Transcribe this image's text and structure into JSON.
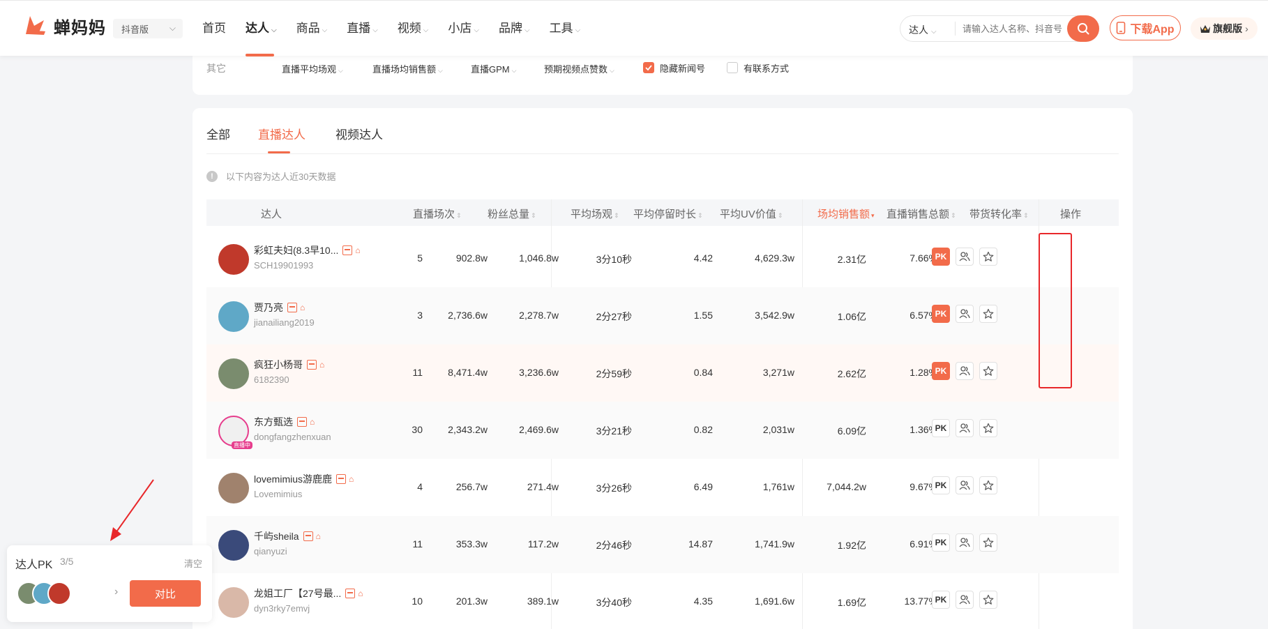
{
  "header": {
    "logo_text": "蝉妈妈",
    "edition": "抖音版",
    "nav": [
      {
        "label": "首页",
        "dropdown": false,
        "active": false
      },
      {
        "label": "达人",
        "dropdown": true,
        "active": true
      },
      {
        "label": "商品",
        "dropdown": true,
        "active": false
      },
      {
        "label": "直播",
        "dropdown": true,
        "active": false
      },
      {
        "label": "视频",
        "dropdown": true,
        "active": false
      },
      {
        "label": "小店",
        "dropdown": true,
        "active": false
      },
      {
        "label": "品牌",
        "dropdown": true,
        "active": false
      },
      {
        "label": "工具",
        "dropdown": true,
        "active": false
      }
    ],
    "search_type": "达人",
    "search_placeholder": "请输入达人名称、抖音号",
    "download_label": "下载App",
    "flagship_label": "旗舰版"
  },
  "filters": {
    "group_label": "其它",
    "dropdowns": [
      "直播平均场观",
      "直播场均销售额",
      "直播GPM",
      "预期视频点赞数"
    ],
    "checkboxes": [
      {
        "label": "隐藏新闻号",
        "checked": true
      },
      {
        "label": "有联系方式",
        "checked": false
      }
    ]
  },
  "tabs": [
    {
      "label": "全部",
      "active": false
    },
    {
      "label": "直播达人",
      "active": true
    },
    {
      "label": "视频达人",
      "active": false
    }
  ],
  "notice": "以下内容为达人近30天数据",
  "columns": [
    "达人",
    "直播场次",
    "粉丝总量",
    "平均场观",
    "平均停留时长",
    "平均UV价值",
    "场均销售额",
    "直播销售总额",
    "带货转化率",
    "操作"
  ],
  "sorted_column": "场均销售额",
  "rows": [
    {
      "name": "彩虹夫妇(8.3早10...",
      "handle": "SCH19901993",
      "sessions": "5",
      "fans": "902.8w",
      "avg_views": "1,046.8w",
      "avg_stay": "3分10秒",
      "uv_value": "4.42",
      "avg_sales": "4,629.3w",
      "total_sales": "2.31亿",
      "conversion": "7.66%",
      "pk_added": true,
      "avatar_color": "#c0392b"
    },
    {
      "name": "贾乃亮",
      "handle": "jianailiang2019",
      "sessions": "3",
      "fans": "2,736.6w",
      "avg_views": "2,278.7w",
      "avg_stay": "2分27秒",
      "uv_value": "1.55",
      "avg_sales": "3,542.9w",
      "total_sales": "1.06亿",
      "conversion": "6.57%",
      "pk_added": true,
      "avatar_color": "#5fa8c7"
    },
    {
      "name": "疯狂小杨哥",
      "handle": "6182390",
      "sessions": "11",
      "fans": "8,471.4w",
      "avg_views": "3,236.6w",
      "avg_stay": "2分59秒",
      "uv_value": "0.84",
      "avg_sales": "3,271w",
      "total_sales": "2.62亿",
      "conversion": "1.28%",
      "pk_added": true,
      "avatar_color": "#7a8c6e"
    },
    {
      "name": "东方甄选",
      "handle": "dongfangzhenxuan",
      "sessions": "30",
      "fans": "2,343.2w",
      "avg_views": "2,469.6w",
      "avg_stay": "3分21秒",
      "uv_value": "0.82",
      "avg_sales": "2,031w",
      "total_sales": "6.09亿",
      "conversion": "1.36%",
      "pk_added": false,
      "avatar_color": "#f0f0f0",
      "live": true,
      "live_label": "直播中"
    },
    {
      "name": "lovemimius游鹿鹿",
      "handle": "Lovemimius",
      "sessions": "4",
      "fans": "256.7w",
      "avg_views": "271.4w",
      "avg_stay": "3分26秒",
      "uv_value": "6.49",
      "avg_sales": "1,761w",
      "total_sales": "7,044.2w",
      "conversion": "9.67%",
      "pk_added": false,
      "avatar_color": "#a0826d"
    },
    {
      "name": "千屿sheila",
      "handle": "qianyuzi",
      "sessions": "11",
      "fans": "353.3w",
      "avg_views": "117.2w",
      "avg_stay": "2分46秒",
      "uv_value": "14.87",
      "avg_sales": "1,741.9w",
      "total_sales": "1.92亿",
      "conversion": "6.91%",
      "pk_added": false,
      "avatar_color": "#3a4a7a"
    },
    {
      "name": "龙姐工厂【27号最...",
      "handle": "dyn3rky7emvj",
      "sessions": "10",
      "fans": "201.3w",
      "avg_views": "389.1w",
      "avg_stay": "3分40秒",
      "uv_value": "4.35",
      "avg_sales": "1,691.6w",
      "total_sales": "1.69亿",
      "conversion": "13.77%",
      "pk_added": false,
      "avatar_color": "#d9b8a8"
    }
  ],
  "pk_panel": {
    "title": "达人PK",
    "count": "3/5",
    "clear_label": "清空",
    "compare_label": "对比"
  },
  "colors": {
    "accent": "#f26b4a",
    "annotation": "#e8272a"
  }
}
